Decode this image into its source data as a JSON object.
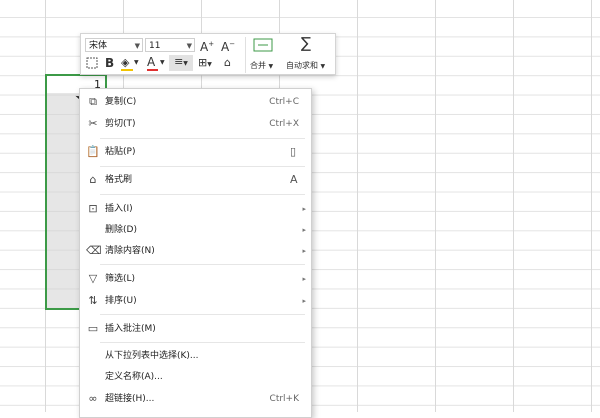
{
  "spreadsheet": {
    "first_cell_value": "1"
  },
  "toolbar": {
    "font_name": "宋体",
    "font_size": "11",
    "increase_font": "A",
    "decrease_font": "A",
    "bold": "B",
    "font_color_glyph": "A",
    "merge_label": "合并",
    "autosum_label": "自动求和"
  },
  "context_menu": {
    "copy": {
      "label": "复制(C)",
      "shortcut": "Ctrl+C"
    },
    "cut": {
      "label": "剪切(T)",
      "shortcut": "Ctrl+X"
    },
    "paste": {
      "label": "粘贴(P)"
    },
    "format_painter": {
      "label": "格式刷"
    },
    "insert": {
      "label": "插入(I)"
    },
    "delete": {
      "label": "删除(D)"
    },
    "clear_contents": {
      "label": "清除内容(N)"
    },
    "filter": {
      "label": "筛选(L)"
    },
    "sort": {
      "label": "排序(U)"
    },
    "insert_comment": {
      "label": "插入批注(M)"
    },
    "pick_from_list": {
      "label": "从下拉列表中选择(K)..."
    },
    "define_name": {
      "label": "定义名称(A)..."
    },
    "hyperlink": {
      "label": "超链接(H)...",
      "shortcut": "Ctrl+K"
    }
  },
  "colors": {
    "selection_border": "#3c9a47",
    "font_color_underline": "#e03030",
    "fill_color_underline": "#f2c400"
  }
}
